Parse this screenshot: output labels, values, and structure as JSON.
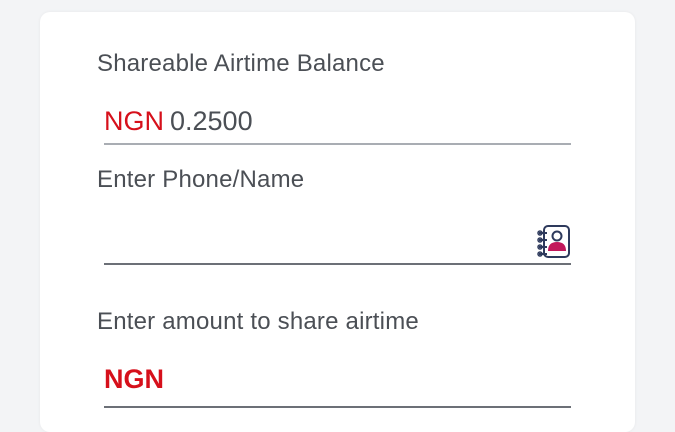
{
  "balance": {
    "label": "Shareable Airtime Balance",
    "currency": "NGN",
    "value": "0.2500"
  },
  "phone": {
    "label": "Enter Phone/Name",
    "value": "",
    "contact_icon": "contact-book-icon"
  },
  "amount": {
    "label": "Enter amount to share airtime",
    "currency": "NGN",
    "value": ""
  },
  "colors": {
    "currency": "#d6101b",
    "text": "#4b4f55",
    "icon_accent": "#c2185b",
    "icon_outline": "#2e3a5c"
  }
}
